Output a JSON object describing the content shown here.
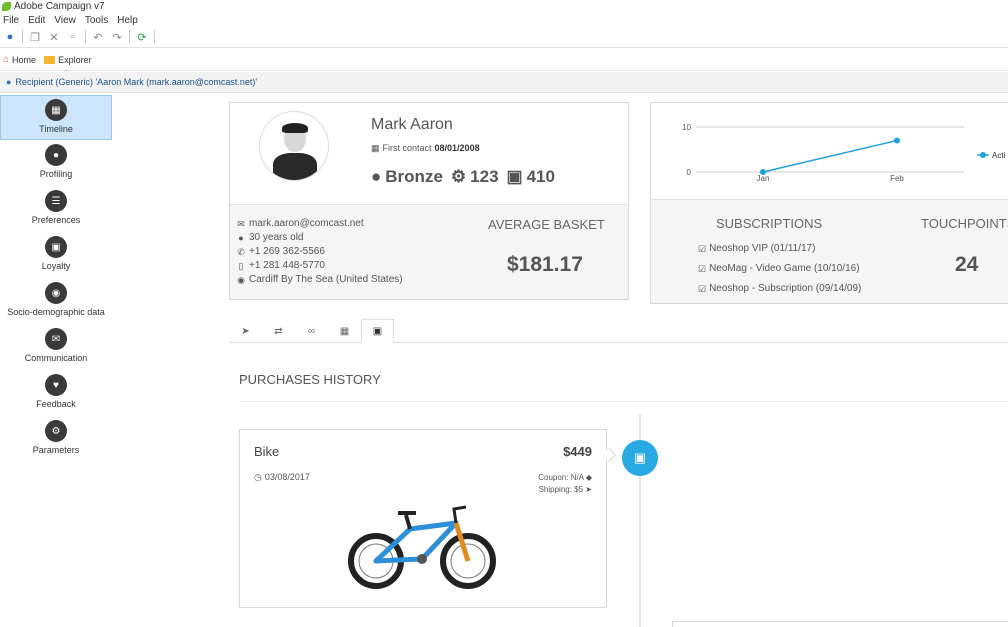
{
  "window": {
    "title": "Adobe Campaign v7"
  },
  "menu": [
    "File",
    "Edit",
    "View",
    "Tools",
    "Help"
  ],
  "nav": {
    "home": "Home",
    "explorer": "Explorer"
  },
  "breadcrumb": "Recipient (Generic) 'Aaron Mark (mark.aaron@comcast.net)'",
  "sidebar": [
    {
      "label": "Timeline",
      "icon": "calendar-icon",
      "active": true
    },
    {
      "label": "Profiling",
      "icon": "users-icon"
    },
    {
      "label": "Preferences",
      "icon": "sliders-icon"
    },
    {
      "label": "Loyalty",
      "icon": "cart-icon"
    },
    {
      "label": "Socio-demographic data",
      "icon": "globe-icon"
    },
    {
      "label": "Communication",
      "icon": "chat-icon"
    },
    {
      "label": "Feedback",
      "icon": "heart-icon"
    },
    {
      "label": "Parameters",
      "icon": "gear-icon"
    }
  ],
  "profile": {
    "name": "Mark Aaron",
    "first_contact_label": "First contact",
    "first_contact_date": "08/01/2008",
    "tier": "Bronze",
    "points": "123",
    "purchases": "410",
    "email": "mark.aaron@comcast.net",
    "age": "30 years old",
    "phone": "+1 269 362-5566",
    "mobile": "+1 281 448-5770",
    "location": "Cardiff By The Sea (United States)",
    "avg_basket_label": "AVERAGE BASKET",
    "avg_basket_value": "$181.17"
  },
  "subscriptions": {
    "label": "SUBSCRIPTIONS",
    "items": [
      "Neoshop VIP (01/11/17)",
      "NeoMag - Video Game (10/10/16)",
      "Neoshop - Subscription (09/14/09)"
    ]
  },
  "touchpoints": {
    "label": "TOUCHPOINTS",
    "value": "24"
  },
  "chart_data": {
    "type": "line",
    "categories": [
      "Jan",
      "Feb"
    ],
    "series": [
      {
        "name": "Acti",
        "values": [
          0,
          7
        ],
        "color": "#1fa3dd"
      }
    ],
    "ylim": [
      0,
      10
    ],
    "yticks": [
      0,
      10
    ],
    "legend": "right"
  },
  "tabs": [
    "send-icon",
    "transfer-icon",
    "link-icon",
    "gift-icon",
    "cart-icon"
  ],
  "purchases": {
    "title": "PURCHASES HISTORY",
    "item": {
      "name": "Bike",
      "price": "$449",
      "date": "03/08/2017",
      "coupon": "Coupon: N/A",
      "shipping": "Shipping: $5"
    }
  },
  "colors": {
    "accent": "#2aaae2",
    "sidebar_active": "#cde6fb"
  }
}
